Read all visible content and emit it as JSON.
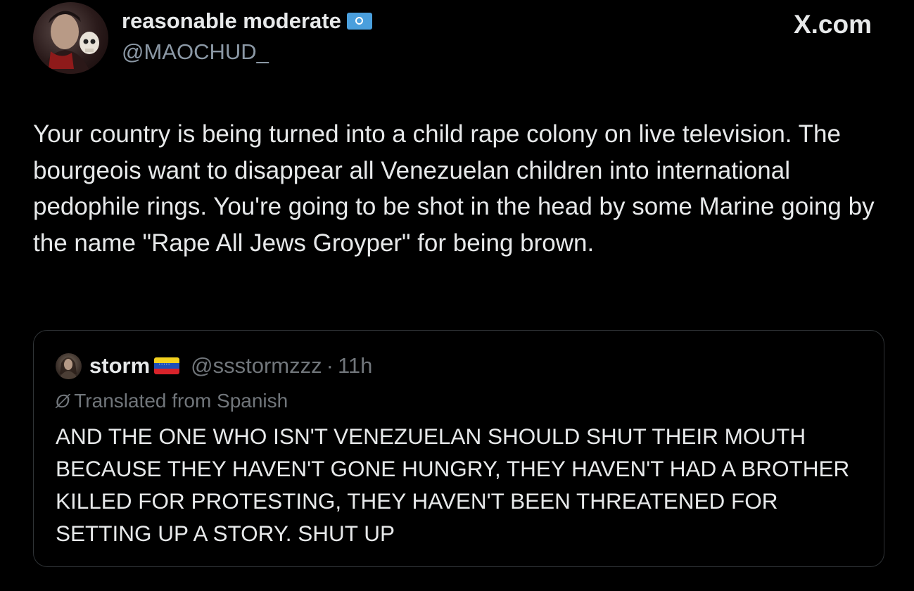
{
  "site": {
    "label": "X.com"
  },
  "author": {
    "display_name": "reasonable moderate",
    "badge_icon": "un-flag-emoji",
    "handle": "@MAOCHUD_",
    "avatar_icon": "avatar-image"
  },
  "tweet": {
    "text": "Your country is being turned into a child rape colony on live television. The bourgeois want to disappear all Venezuelan children into international pedophile rings. You're going to be shot in the head by some Marine going by the name \"Rape All Jews Groyper\" for being brown."
  },
  "quote": {
    "display_name": "storm",
    "flag_icon": "venezuela-flag-emoji",
    "handle": "@ssstormzzz",
    "separator": "·",
    "time": "11h",
    "translated_label": "Translated from Spanish",
    "translate_icon": "translate-icon",
    "text": "AND THE ONE WHO ISN'T VENEZUELAN SHOULD SHUT THEIR MOUTH BECAUSE THEY HAVEN'T GONE HUNGRY, THEY HAVEN'T HAD A BROTHER KILLED FOR PROTESTING, THEY HAVEN'T BEEN THREATENED FOR SETTING UP A STORY. SHUT UP"
  },
  "colors": {
    "background": "#000000",
    "primary_text": "#e7e9ea",
    "secondary_text": "#71767b",
    "border": "#2f3336",
    "un_blue": "#4a9fdd"
  }
}
